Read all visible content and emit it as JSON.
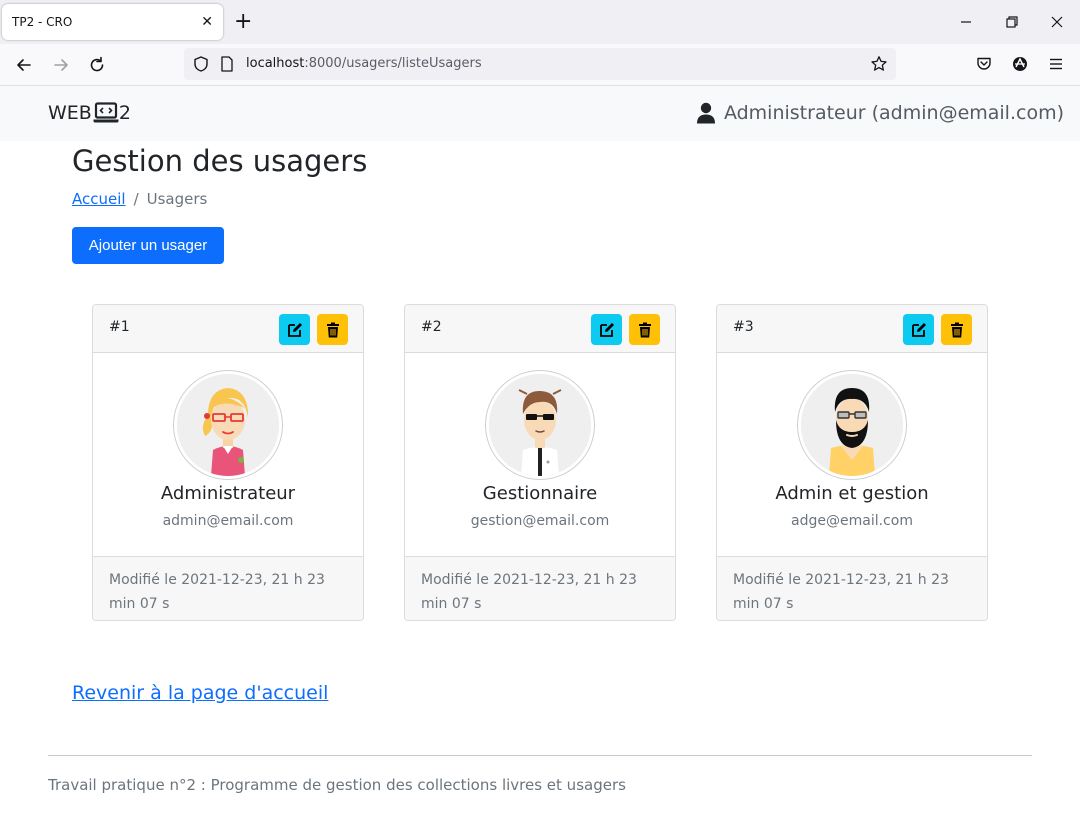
{
  "browser": {
    "tab_title": "TP2 - CRO",
    "url_host": "localhost",
    "url_path": ":8000/usagers/listeUsagers"
  },
  "header": {
    "brand_left": "WEB",
    "brand_right": "2",
    "user_label": "Administrateur (admin@email.com)"
  },
  "main": {
    "title": "Gestion des usagers",
    "breadcrumb": {
      "home": "Accueil",
      "separator": "/",
      "current": "Usagers"
    },
    "add_button": "Ajouter un usager",
    "users": [
      {
        "id": "#1",
        "name": "Administrateur",
        "email": "admin@email.com",
        "modified": "Modifié le 2021-12-23, 21 h 23 min 07 s",
        "avatar": "woman-glasses-avatar"
      },
      {
        "id": "#2",
        "name": "Gestionnaire",
        "email": "gestion@email.com",
        "modified": "Modifié le 2021-12-23, 21 h 23 min 07 s",
        "avatar": "man-sunglasses-avatar"
      },
      {
        "id": "#3",
        "name": "Admin et gestion",
        "email": "adge@email.com",
        "modified": "Modifié le 2021-12-23, 21 h 23 min 07 s",
        "avatar": "bearded-man-avatar"
      }
    ],
    "back_link": "Revenir à la page d'accueil"
  },
  "footer": {
    "text": "Travail pratique n°2 : Programme de gestion des collections livres et usagers"
  },
  "colors": {
    "primary": "#0d6efd",
    "info": "#0dcaf0",
    "warning": "#ffc107",
    "muted": "#6c757d"
  }
}
